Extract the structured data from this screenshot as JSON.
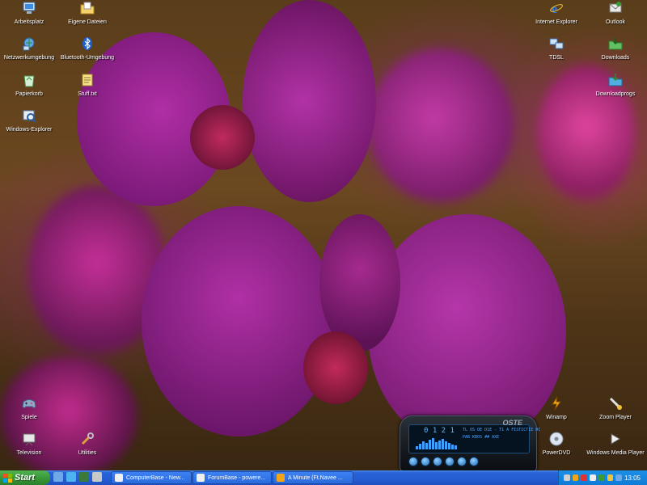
{
  "desktop_icons": {
    "arbeitsplatz": {
      "label": "Arbeitsplatz",
      "icon": "computer-icon"
    },
    "eigene_dateien": {
      "label": "Eigene Dateien",
      "icon": "documents-folder-icon"
    },
    "netzwerkumgebung": {
      "label": "Netzwerkumgebung",
      "icon": "network-icon"
    },
    "bluetooth": {
      "label": "Bluetooth-Umgebung",
      "icon": "bluetooth-icon"
    },
    "papierkorb": {
      "label": "Papierkorb",
      "icon": "recycle-bin-icon"
    },
    "stuff": {
      "label": "Stuff.txt",
      "icon": "text-file-icon"
    },
    "windows_explorer": {
      "label": "Windows-Explorer",
      "icon": "explorer-icon"
    },
    "internet_explorer": {
      "label": "Internet Explorer",
      "icon": "internet-explorer-icon"
    },
    "outlook": {
      "label": "Outlook",
      "icon": "mail-icon"
    },
    "tdsl": {
      "label": "TDSL",
      "icon": "connection-icon"
    },
    "downloads": {
      "label": "Downloads",
      "icon": "downloads-folder-icon"
    },
    "downloadprogs": {
      "label": "Downloadprogs",
      "icon": "folder-icon"
    },
    "spiele": {
      "label": "Spiele",
      "icon": "gamepad-icon"
    },
    "television": {
      "label": "Television",
      "icon": "television-icon"
    },
    "utilities": {
      "label": "Utilities",
      "icon": "wrench-icon"
    },
    "winamp": {
      "label": "Winamp",
      "icon": "winamp-icon"
    },
    "zoom_player": {
      "label": "Zoom Player",
      "icon": "zoom-player-icon"
    },
    "powerdvd": {
      "label": "PowerDVD",
      "icon": "dvd-icon"
    },
    "wmp": {
      "label": "Windows Media Player",
      "icon": "media-player-icon"
    }
  },
  "winamp": {
    "time": "0 1 2 1",
    "brand": "OSTE",
    "ticker": "TL   OS  OE  D1E  -  T1  A  FISTICTIE  HC",
    "info": "PAB  KBOS  ## AXE",
    "spectrum": [
      4,
      7,
      10,
      8,
      12,
      14,
      9,
      11,
      13,
      10,
      8,
      6,
      5
    ]
  },
  "taskbar": {
    "start_label": "Start",
    "tasks": [
      {
        "label": "ComputerBase - New..."
      },
      {
        "label": "ForumBase - powere..."
      },
      {
        "label": "A Minute (Ft.Navee ..."
      }
    ],
    "clock": "13:05"
  },
  "colors": {
    "taskbar_blue": "#245dd3",
    "start_green": "#3a9a3a",
    "tray_blue": "#0f7bd6",
    "orchid": "#b0259c"
  }
}
